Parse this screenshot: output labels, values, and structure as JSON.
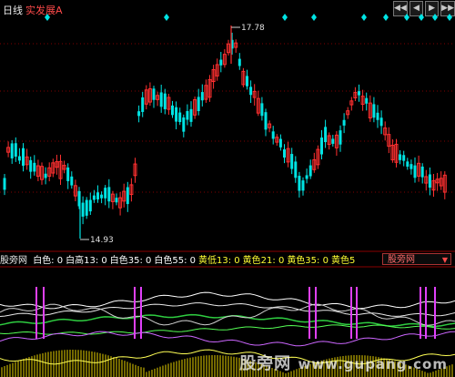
{
  "header": {
    "period": "日线",
    "stock_name": "实发展A",
    "nav_icons": [
      "rewind-icon",
      "step-back-icon",
      "step-forward-icon",
      "fast-forward-icon"
    ]
  },
  "price_labels": {
    "high": "17.78",
    "low": "14.93"
  },
  "indicator_bar": {
    "name": "股旁网",
    "items": [
      {
        "text": "白色: 0",
        "color": "#ffffff"
      },
      {
        "text": "白高13: 0",
        "color": "#ffffff"
      },
      {
        "text": "白色35: 0",
        "color": "#ffffff"
      },
      {
        "text": "白色55: 0",
        "color": "#ffffff"
      },
      {
        "text": "黄低13: 0",
        "color": "#ffff33"
      },
      {
        "text": "黄色21: 0",
        "color": "#ffff33"
      },
      {
        "text": "黄色35: 0",
        "color": "#ffff33"
      },
      {
        "text": "黄色5",
        "color": "#ffff33"
      }
    ],
    "selector_label": "股旁网"
  },
  "watermark": {
    "cn": "股旁网",
    "url": "www.gupang.com"
  },
  "colors": {
    "up": "#ff3030",
    "down": "#00e4e4",
    "diamond": "#00e4e4",
    "grid": "#800000"
  }
}
